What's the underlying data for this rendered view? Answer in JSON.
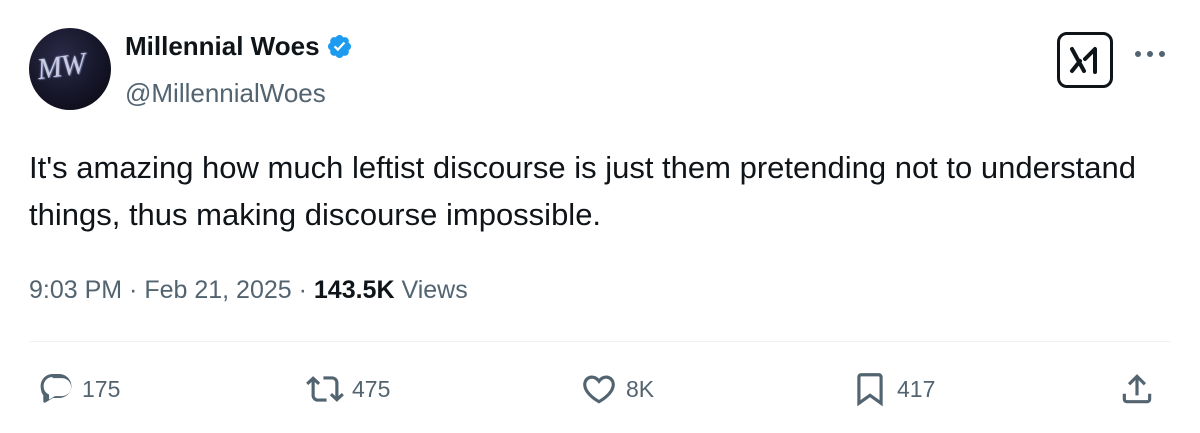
{
  "author": {
    "display_name": "Millennial Woes",
    "handle": "@MillennialWoes",
    "avatar_text": "MW",
    "verified": true
  },
  "tweet": {
    "text": "It's amazing how much leftist discourse is just them pretending not to understand things, thus making discourse impossible."
  },
  "meta": {
    "time": "9:03 PM",
    "separator": " · ",
    "date": "Feb 21, 2025",
    "views_count": "143.5K",
    "views_label": "Views"
  },
  "actions": {
    "replies": "175",
    "reposts": "475",
    "likes": "8K",
    "bookmarks": "417"
  },
  "icons": {
    "verified": "verified-badge-icon",
    "grok": "grok-icon",
    "more": "more-horizontal-icon",
    "reply": "reply-icon",
    "repost": "repost-icon",
    "like": "heart-icon",
    "bookmark": "bookmark-icon",
    "share": "share-icon"
  },
  "colors": {
    "text": "#0f1419",
    "secondary": "#536471",
    "verified": "#1d9bf0",
    "divider": "#eff3f4"
  }
}
